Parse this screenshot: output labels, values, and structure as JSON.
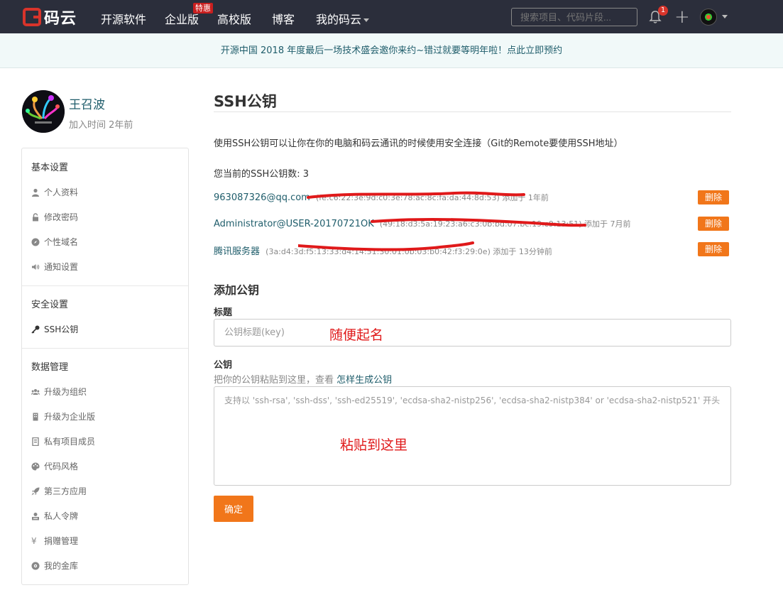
{
  "header": {
    "logo_text": "码云",
    "nav": [
      "开源软件",
      "企业版",
      "高校版",
      "博客",
      "我的码云"
    ],
    "enterprise_badge": "特惠",
    "search_placeholder": "搜索项目、代码片段...",
    "notification_count": "1"
  },
  "announcement": "开源中国 2018 年度最后一场技术盛会邀你来约~错过就要等明年啦！点此立即预约",
  "profile": {
    "name": "王召波",
    "joined": "加入时间 2年前"
  },
  "sidebar": {
    "groups": [
      {
        "heading": "基本设置",
        "items": [
          "个人资料",
          "修改密码",
          "个性域名",
          "通知设置"
        ]
      },
      {
        "heading": "安全设置",
        "items": [
          "SSH公钥"
        ]
      },
      {
        "heading": "数据管理",
        "items": [
          "升级为组织",
          "升级为企业版",
          "私有项目成员",
          "代码风格",
          "第三方应用",
          "私人令牌",
          "捐赠管理",
          "我的金库"
        ]
      }
    ],
    "icons": [
      "user-icon",
      "lock-icon",
      "compass-icon",
      "volume-icon",
      "key-icon",
      "group-icon",
      "building-icon",
      "member-icon",
      "palette-icon",
      "rocket-icon",
      "token-icon",
      "yen-icon",
      "vault-icon"
    ]
  },
  "main": {
    "title": "SSH公钥",
    "description": "使用SSH公钥可以让你在你的电脑和码云通讯的时候使用安全连接（Git的Remote要使用SSH地址）",
    "count_text": "您当前的SSH公钥数: 3",
    "keys": [
      {
        "name": "963087326@qq.com",
        "meta": "(fe:c6:22:3e:9d:c0:3e:78:ac:8c:fa:da:44:8d:53) 添加于 1年前",
        "delete": "删除"
      },
      {
        "name": "Administrator@USER-20170721OK",
        "meta": "(49:18:d3:5a:19:23:a6:c3:0b:bd:07:bc:19:c9:13:51) 添加于 7月前",
        "delete": "删除"
      },
      {
        "name": "腾讯服务器",
        "meta": "(3a:d4:3d:f5:13:33:d4:14:51:30:01:0b:03:b0:42:f3:29:0e) 添加于 13分钟前",
        "delete": "删除"
      }
    ],
    "add_title": "添加公钥",
    "field_title_label": "标题",
    "field_title_placeholder": "公钥标题(key)",
    "title_annotation": "随便起名",
    "field_key_label": "公钥",
    "field_key_hint": "把你的公钥粘贴到这里，查看",
    "field_key_hint_link": "怎样生成公钥",
    "field_key_placeholder": "支持以 'ssh-rsa', 'ssh-dss', 'ssh-ed25519', 'ecdsa-sha2-nistp256', 'ecdsa-sha2-nistp384' or 'ecdsa-sha2-nistp521' 开头",
    "key_annotation": "粘贴到这里",
    "submit_label": "确定"
  },
  "colors": {
    "topbar": "#2b2e3b",
    "accent": "#f1761a",
    "link": "#1f5d6b",
    "annotation": "#e0191a"
  }
}
